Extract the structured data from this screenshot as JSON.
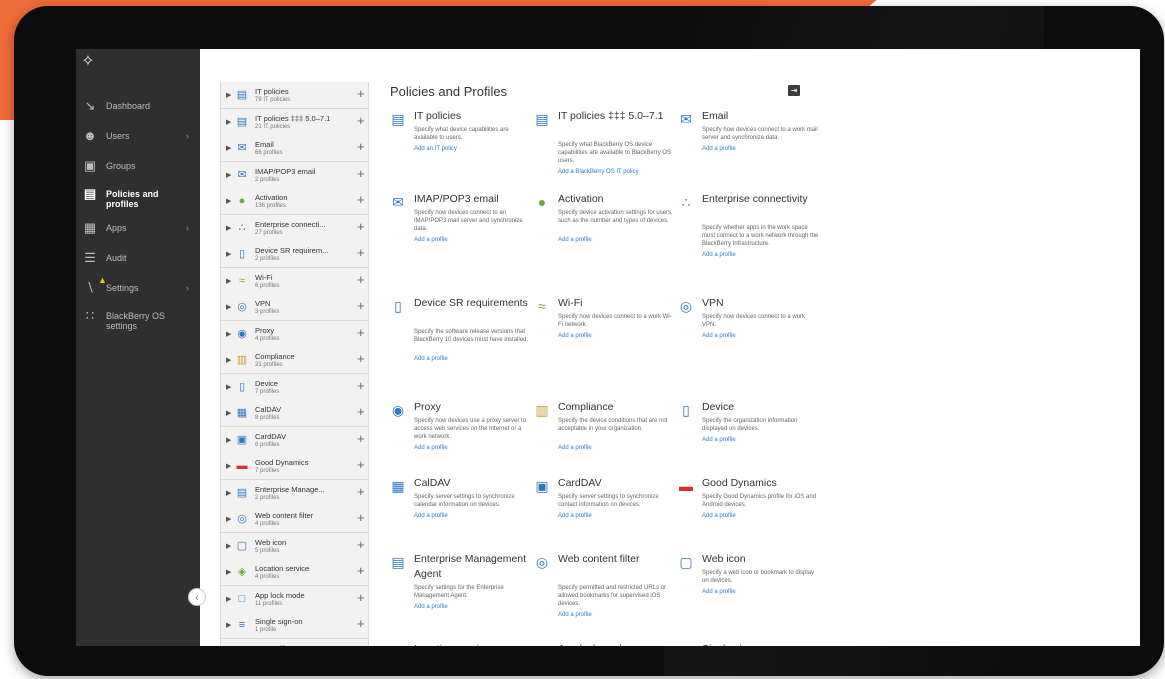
{
  "nav": {
    "logo_icon": "blackberry-logo-icon",
    "items": [
      {
        "label": "Dashboard",
        "icon": "chart-icon"
      },
      {
        "label": "Users",
        "icon": "users-icon"
      },
      {
        "label": "Groups",
        "icon": "groups-icon"
      },
      {
        "label": "Policies and profiles",
        "icon": "document-icon"
      },
      {
        "label": "Apps",
        "icon": "apps-grid-icon"
      },
      {
        "label": "Audit",
        "icon": "audit-icon"
      },
      {
        "label": "Settings",
        "icon": "wrench-icon"
      },
      {
        "label": "BlackBerry OS settings",
        "icon": "blackberry-icon"
      }
    ],
    "collapse_glyph": "‹"
  },
  "list": {
    "rows": [
      {
        "name": "IT policies",
        "count": "79 IT policies",
        "icon": "it-policy-icon",
        "color": "#2e79c6"
      },
      {
        "name": "IT policies ‡‡‡ 5.0–7.1",
        "count": "21 IT policies",
        "icon": "it-policy-icon",
        "color": "#2e79c6"
      },
      {
        "name": "Email",
        "count": "66 profiles",
        "icon": "email-icon",
        "color": "#2e79c6"
      },
      {
        "name": "IMAP/POP3 email",
        "count": "2 profiles",
        "icon": "email-icon",
        "color": "#2e79c6"
      },
      {
        "name": "Activation",
        "count": "136 profiles",
        "icon": "activation-icon",
        "color": "#6aa83b"
      },
      {
        "name": "Enterprise connecti...",
        "count": "27 profiles",
        "icon": "enterprise-connectivity-icon",
        "color": "#2e79c6"
      },
      {
        "name": "Device SR requirem...",
        "count": "2 profiles",
        "icon": "device-sr-icon",
        "color": "#2e79c6"
      },
      {
        "name": "Wi-Fi",
        "count": "6 profiles",
        "icon": "wifi-icon",
        "color": "#6aa83b"
      },
      {
        "name": "VPN",
        "count": "3 profiles",
        "icon": "vpn-icon",
        "color": "#2e79c6"
      },
      {
        "name": "Proxy",
        "count": "4 profiles",
        "icon": "proxy-icon",
        "color": "#2e79c6"
      },
      {
        "name": "Compliance",
        "count": "21 profiles",
        "icon": "compliance-icon",
        "color": "#c6a22e"
      },
      {
        "name": "Device",
        "count": "7 profiles",
        "icon": "device-icon",
        "color": "#2e79c6"
      },
      {
        "name": "CalDAV",
        "count": "8 profiles",
        "icon": "caldav-icon",
        "color": "#2e79c6"
      },
      {
        "name": "CardDAV",
        "count": "6 profiles",
        "icon": "carddav-icon",
        "color": "#2e79c6"
      },
      {
        "name": "Good Dynamics",
        "count": "7 profiles",
        "icon": "good-dynamics-icon",
        "color": "#d9302c"
      },
      {
        "name": "Enterprise Manage...",
        "count": "2 profiles",
        "icon": "enterprise-management-icon",
        "color": "#2e79c6"
      },
      {
        "name": "Web content filter",
        "count": "4 profiles",
        "icon": "web-content-filter-icon",
        "color": "#2e79c6"
      },
      {
        "name": "Web icon",
        "count": "5 profiles",
        "icon": "web-icon-icon",
        "color": "#2e79c6"
      },
      {
        "name": "Location service",
        "count": "4 profiles",
        "icon": "location-icon",
        "color": "#6aa83b"
      },
      {
        "name": "App lock mode",
        "count": "11 profiles",
        "icon": "app-lock-icon",
        "color": "#2e79c6"
      },
      {
        "name": "Single sign-on",
        "count": "1 profile",
        "icon": "single-sign-on-icon",
        "color": "#2e79c6"
      },
      {
        "name": "CA certificate",
        "count": "",
        "icon": "ca-certificate-icon",
        "color": "#d9302c"
      }
    ]
  },
  "content": {
    "title": "Policies and Profiles",
    "export_icon": "export-icon",
    "cards": [
      {
        "title": "IT policies",
        "desc": "Specify what device capabilities are available to users.",
        "link": "Add an IT policy",
        "icon": "it-policy-icon",
        "color": "#2e79c6"
      },
      {
        "title": "IT policies ‡‡‡ 5.0–7.1",
        "desc": "Specify what BlackBerry OS device capabilities are available to BlackBerry OS users.",
        "link": "Add a BlackBerry OS IT policy",
        "icon": "it-policy-icon",
        "color": "#2e79c6"
      },
      {
        "title": "Email",
        "desc": "Specify how devices connect to a work mail server and synchronize data.",
        "link": "Add a profile",
        "icon": "email-icon",
        "color": "#2e79c6"
      },
      {
        "title": "IMAP/POP3 email",
        "desc": "Specify how devices connect to an IMAP/POP3 mail server and synchronize data.",
        "link": "Add a profile",
        "icon": "email-icon",
        "color": "#2e79c6"
      },
      {
        "title": "Activation",
        "desc": "Specify device activation settings for users, such as the number and types of devices.",
        "link": "Add a profile",
        "icon": "activation-icon",
        "color": "#6aa83b"
      },
      {
        "title": "Enterprise connectivity",
        "desc": "Specify whether apps in the work space must connect to a work network through the BlackBerry Infrastructure.",
        "link": "Add a profile",
        "icon": "enterprise-connectivity-icon",
        "color": "#2e79c6"
      },
      {
        "title": "Device SR requirements",
        "desc": "Specify the software release versions that BlackBerry 10 devices must have installed.",
        "link": "Add a profile",
        "icon": "device-sr-icon",
        "color": "#2e79c6"
      },
      {
        "title": "Wi-Fi",
        "desc": "Specify how devices connect to a work Wi-Fi network.",
        "link": "Add a profile",
        "icon": "wifi-icon",
        "color": "#6aa83b"
      },
      {
        "title": "VPN",
        "desc": "Specify how devices connect to a work VPN.",
        "link": "Add a profile",
        "icon": "vpn-icon",
        "color": "#2e79c6"
      },
      {
        "title": "Proxy",
        "desc": "Specify how devices use a proxy server to access web services on the Internet or a work network.",
        "link": "Add a profile",
        "icon": "proxy-icon",
        "color": "#2e79c6"
      },
      {
        "title": "Compliance",
        "desc": "Specify the device conditions that are not acceptable in your organization.",
        "link": "Add a profile",
        "icon": "compliance-icon",
        "color": "#c6a22e"
      },
      {
        "title": "Device",
        "desc": "Specify the organization information displayed on devices.",
        "link": "Add a profile",
        "icon": "device-icon",
        "color": "#2e79c6"
      },
      {
        "title": "CalDAV",
        "desc": "Specify server settings to synchronize calendar information on devices.",
        "link": "Add a profile",
        "icon": "caldav-icon",
        "color": "#2e79c6"
      },
      {
        "title": "CardDAV",
        "desc": "Specify server settings to synchronize contact information on devices.",
        "link": "Add a profile",
        "icon": "carddav-icon",
        "color": "#2e79c6"
      },
      {
        "title": "Good Dynamics",
        "desc": "Specify Good Dynamics profile for iOS and Android devices.",
        "link": "Add a profile",
        "icon": "good-dynamics-icon",
        "color": "#d9302c"
      },
      {
        "title": "Enterprise Management Agent",
        "desc": "Specify settings for the Enterprise Management Agent.",
        "link": "Add a profile",
        "icon": "enterprise-management-icon",
        "color": "#2e79c6"
      },
      {
        "title": "Web content filter",
        "desc": "Specify permitted and restricted URLs or allowed bookmarks for supervised iOS devices.",
        "link": "Add a profile",
        "icon": "web-content-filter-icon",
        "color": "#2e79c6"
      },
      {
        "title": "Web icon",
        "desc": "Specify a web icon or bookmark to display on devices.",
        "link": "Add a profile",
        "icon": "web-icon-icon",
        "color": "#2e79c6"
      },
      {
        "title": "Location service",
        "desc": "",
        "link": "",
        "icon": "location-icon",
        "color": "#6aa83b"
      },
      {
        "title": "App lock mode",
        "desc": "",
        "link": "",
        "icon": "app-lock-icon",
        "color": "#2e79c6"
      },
      {
        "title": "Single sign-on",
        "desc": "",
        "link": "",
        "icon": "single-sign-on-icon",
        "color": "#2e79c6"
      }
    ]
  },
  "colors": {
    "accent_orange": "#ee6b3a",
    "link_blue": "#2e79c6",
    "nav_bg": "#2f2f2f"
  }
}
